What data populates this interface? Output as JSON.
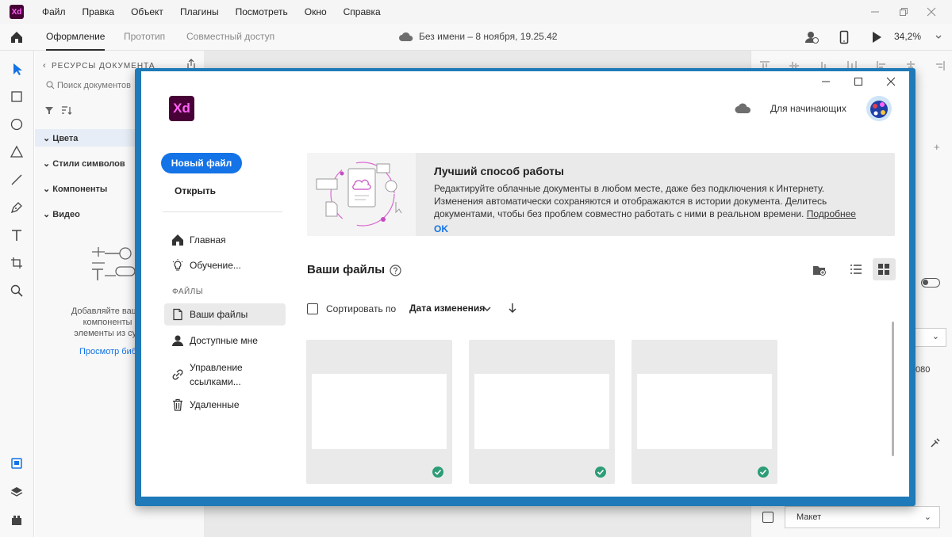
{
  "app": {
    "logo": "Xd"
  },
  "menu": [
    "Файл",
    "Правка",
    "Объект",
    "Плагины",
    "Посмотреть",
    "Окно",
    "Справка"
  ],
  "toolbar": {
    "tabs": [
      "Оформление",
      "Прототип",
      "Совместный доступ"
    ],
    "doc_title": "Без имени – 8 ноября, 19.25.42",
    "zoom": "34,2%"
  },
  "assets": {
    "header": "РЕСУРСЫ ДОКУМЕНТА",
    "search_placeholder": "Поиск документов",
    "sections": [
      "Цвета",
      "Стили символов",
      "Компоненты",
      "Видео"
    ],
    "empty_text_1": "Добавляйте ваши собст",
    "empty_text_2": "компоненты или и",
    "empty_text_3": "элементы из существу",
    "link": "Просмотр биб"
  },
  "props": {
    "value": "080",
    "select": "Макет"
  },
  "home": {
    "logo": "Xd",
    "beginner": "Для начинающих",
    "new_file": "Новый файл",
    "open": "Открыть",
    "nav": {
      "home": "Главная",
      "learn": "Обучение...",
      "files_header": "ФАЙЛЫ",
      "your_files": "Ваши файлы",
      "shared": "Доступные мне",
      "links_1": "Управление",
      "links_2": "ссылками...",
      "deleted": "Удаленные"
    },
    "banner": {
      "title": "Лучший способ работы",
      "text": "Редактируйте облачные документы в любом месте, даже без подключения к Интернету. Изменения автоматически сохраняются и отображаются в истории документа. Делитесь документами, чтобы без проблем совместно работать с ними в реальном времени.",
      "more": "Подробнее",
      "ok": "OK"
    },
    "files": {
      "title": "Ваши файлы",
      "sort_label": "Сортировать по",
      "sort_value": "Дата изменения",
      "count": 3
    }
  },
  "colors": {
    "accent": "#1473e6",
    "brand": "#470137",
    "brand_text": "#ff61f6",
    "frame": "#1e7ab8",
    "synced": "#2d9d78"
  }
}
